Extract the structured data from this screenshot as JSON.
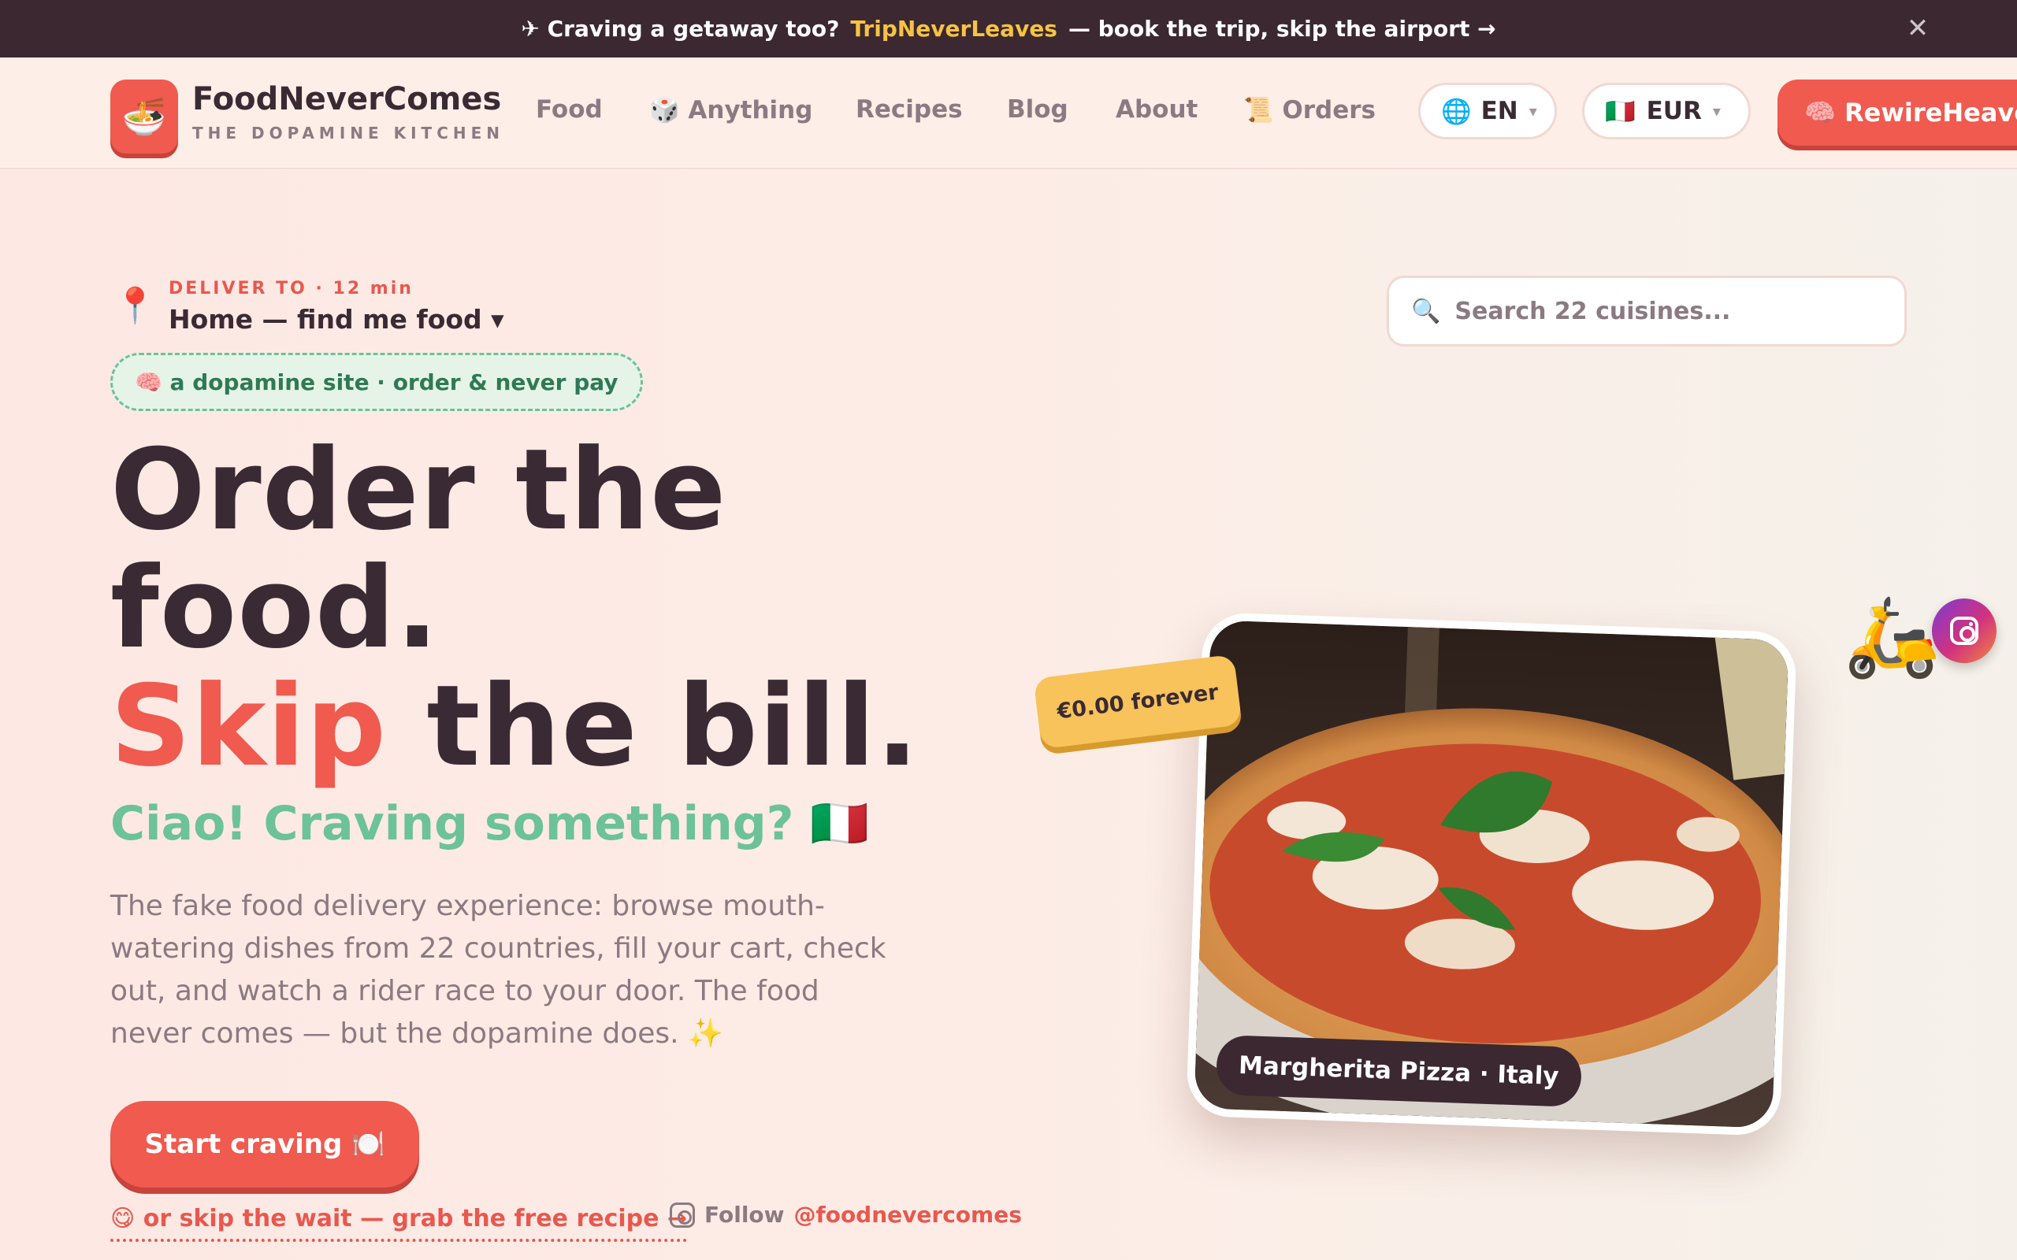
{
  "announcement": {
    "lead": "✈ Craving a getaway too?",
    "highlight": "TripNeverLeaves",
    "tail": "— book the trip, skip the airport →",
    "close_glyph": "✕"
  },
  "brand": {
    "logo_glyph": "🍜",
    "name": "FoodNeverComes",
    "tagline": "THE DOPAMINE KITCHEN"
  },
  "nav": {
    "items": [
      {
        "label": "Food"
      },
      {
        "label": "🎲 Anything"
      },
      {
        "label": "Recipes"
      },
      {
        "label": "Blog"
      },
      {
        "label": "About"
      },
      {
        "label": "📜 Orders"
      }
    ],
    "language": {
      "icon": "🌐",
      "value": "EN"
    },
    "currency": {
      "icon": "🇮🇹",
      "value": "EUR"
    },
    "caret": "▾",
    "cta": "🧠 RewireHeaven"
  },
  "delivery": {
    "icon": "📍",
    "label": "DELIVER TO · 12 min",
    "value": "Home — find me food ▾"
  },
  "badge": "🧠 a dopamine site · order & never pay",
  "hero": {
    "line1": "Order the",
    "line2": "food.",
    "line3_red": "Skip",
    "line3_rest": " the bill.",
    "subtitle": "Ciao! Craving something? 🇮🇹",
    "description": "The fake food delivery experience: browse mouth-watering dishes from 22 countries, fill your cart, check out, and watch a rider race to your door. The food never comes — but the dopamine does. ✨",
    "start_button": "Start craving 🍽️",
    "recipe_link": "😋 or skip the wait — grab the free recipe →",
    "follow_label": "Follow",
    "follow_handle": "@foodnevercomes"
  },
  "search": {
    "icon": "🔍",
    "placeholder": "Search 22 cuisines..."
  },
  "feature": {
    "price_tag": "€0.00 forever",
    "caption": "Margherita Pizza · Italy",
    "scooter": "🛵"
  },
  "colors": {
    "accent": "#f05a4f",
    "green": "#6cc299",
    "dark": "#3b2830",
    "gold": "#f6c344"
  }
}
